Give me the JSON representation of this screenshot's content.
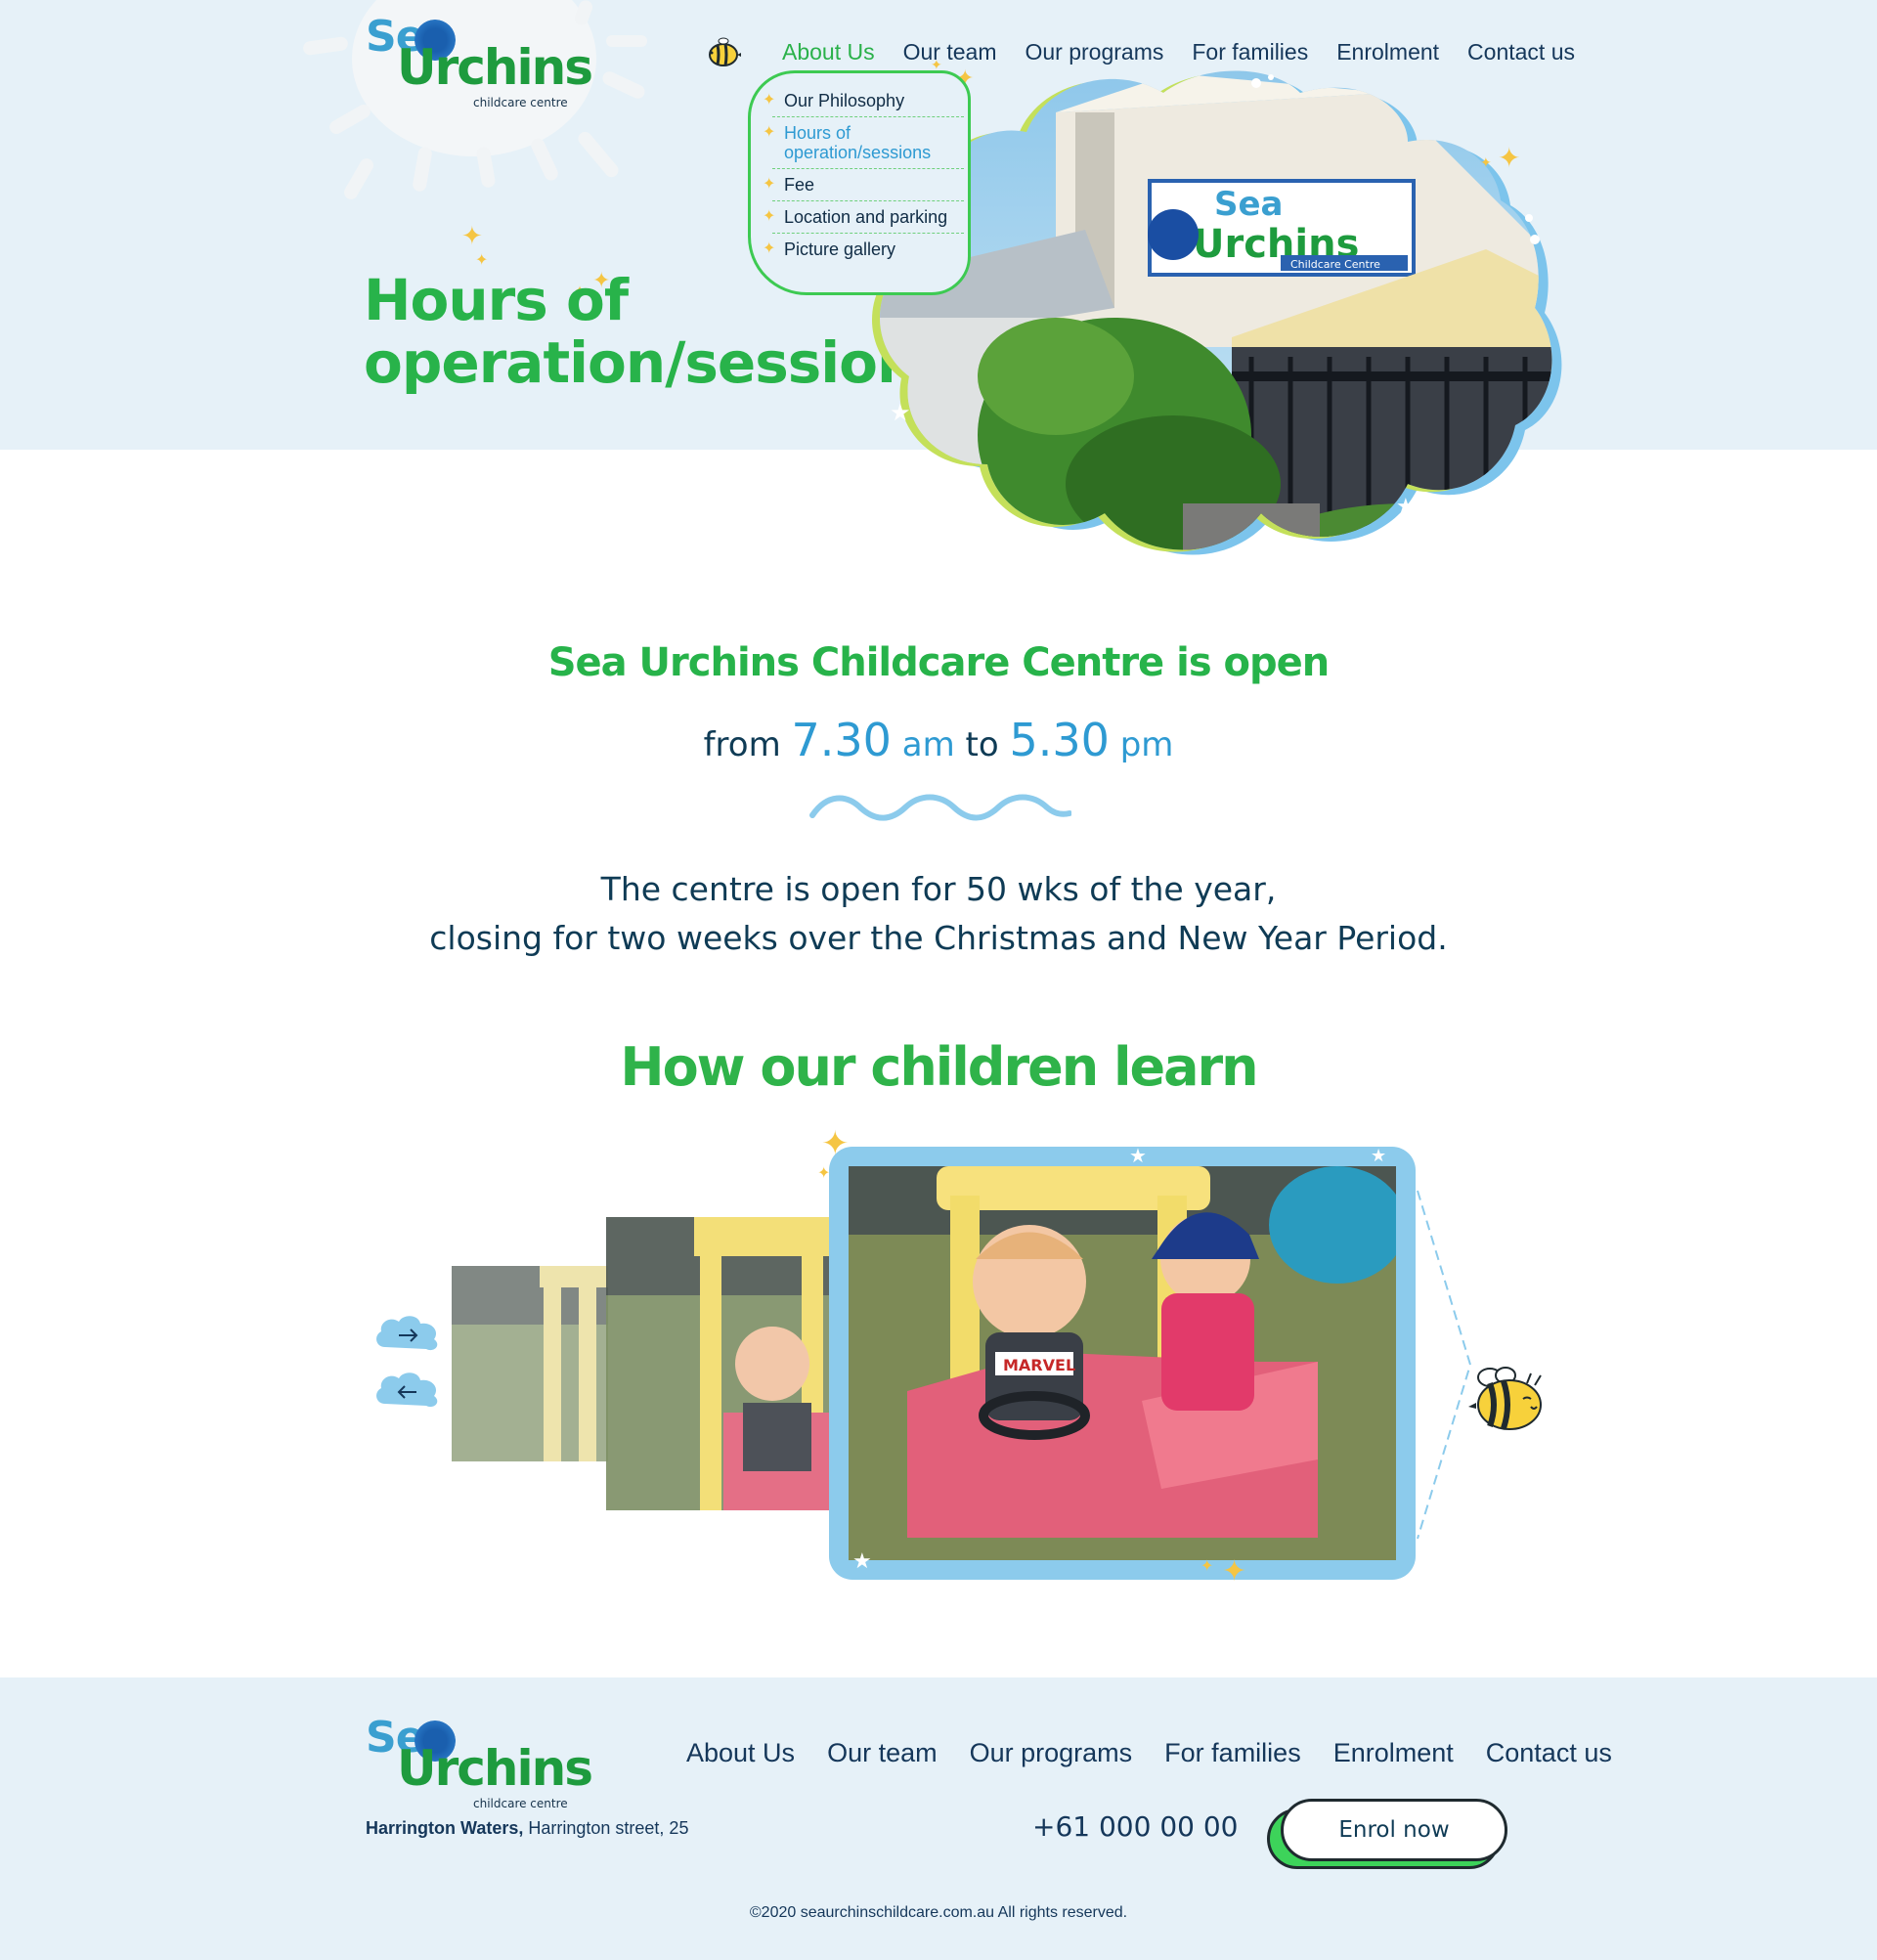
{
  "brand": {
    "logo_sea": "Sea",
    "logo_urchins": "Urchins",
    "logo_tagline": "childcare centre"
  },
  "nav": {
    "items": [
      "About Us",
      "Our team",
      "Our programs",
      "For families",
      "Enrolment",
      "Contact us"
    ],
    "active": "About Us"
  },
  "submenu": {
    "items": [
      "Our Philosophy",
      "Hours of operation/sessions",
      "Fee",
      "Location and parking",
      "Picture gallery"
    ],
    "active": "Hours of operation/sessions"
  },
  "hero": {
    "title_line1": "Hours of",
    "title_line2": "operation/sessions",
    "sign_text_sea": "Sea",
    "sign_text_urchins": "Urchins",
    "sign_tagline": "Childcare Centre"
  },
  "hours": {
    "title": "Sea Urchins Childcare Centre is open",
    "from_label": "from",
    "open_time": "7.30",
    "open_unit": "am",
    "to_label": "to",
    "close_time": "5.30",
    "close_unit": "pm",
    "note_line1": "The centre is open for 50 wks of the year,",
    "note_line2": "closing for two weeks over the Christmas and New Year Period."
  },
  "learn": {
    "title": "How our children learn",
    "next_icon": "arrow-right-icon",
    "prev_icon": "arrow-left-icon",
    "shirt_text": "MARVEL"
  },
  "footer": {
    "nav": [
      "About Us",
      "Our team",
      "Our programs",
      "For families",
      "Enrolment",
      "Contact us"
    ],
    "address_bold": "Harrington Waters,",
    "address_rest": "Harrington street, 25",
    "phone": "+61 000 00 00",
    "enrol_button": "Enrol now",
    "copyright": "©2020 seaurchinschildcare.com.au All rights reserved."
  },
  "colors": {
    "green": "#2ab14a",
    "blue": "#2e9ad2",
    "navy": "#0f3b55",
    "hero_bg": "#e6f1f8",
    "star": "#f5c543"
  }
}
